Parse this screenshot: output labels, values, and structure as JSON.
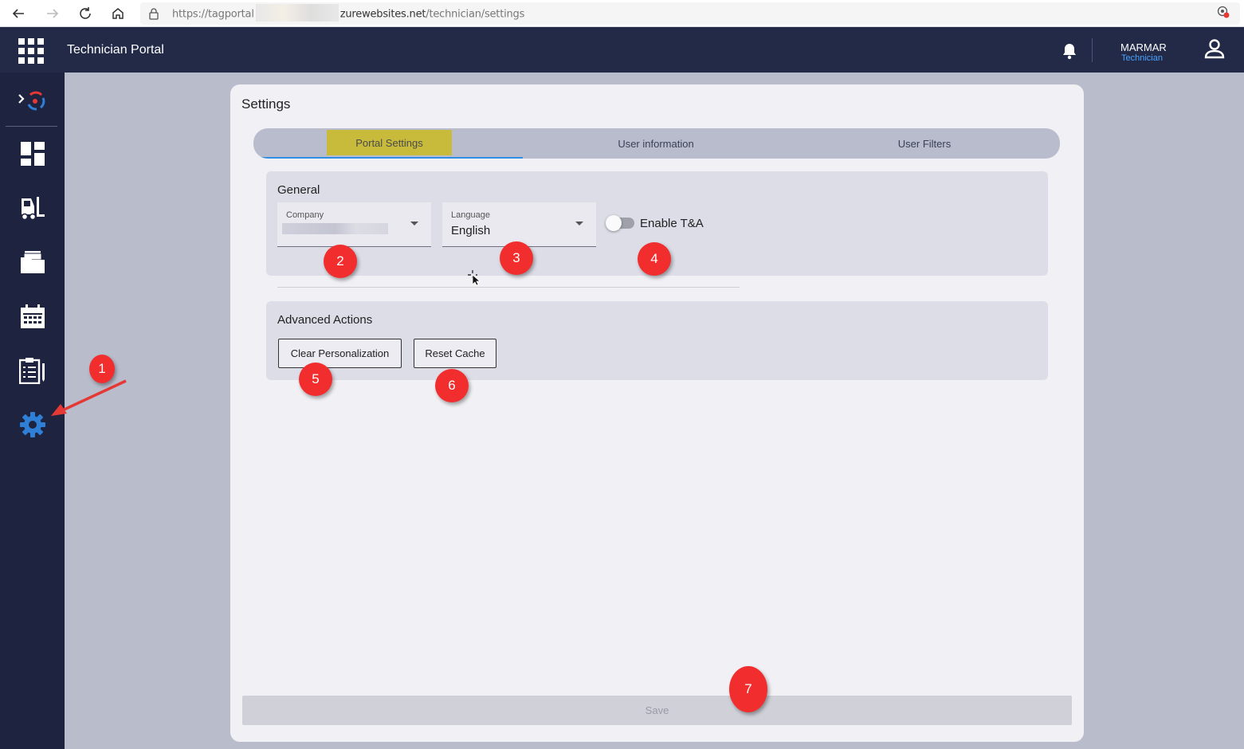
{
  "browser": {
    "url_prefix": "https://tagportal",
    "url_domain_suffix": "zurewebsites.net",
    "url_path": "/technician/settings"
  },
  "appbar": {
    "title": "Technician Portal",
    "user_name": "MARMAR",
    "user_role": "Technician"
  },
  "sidebar": {
    "items": [
      {
        "name": "logo",
        "icon": "logo-icon"
      },
      {
        "name": "dashboard",
        "icon": "dashboard-icon"
      },
      {
        "name": "equipment",
        "icon": "forklift-icon"
      },
      {
        "name": "documents",
        "icon": "folder-icon"
      },
      {
        "name": "calendar",
        "icon": "calendar-icon"
      },
      {
        "name": "checklist",
        "icon": "clipboard-icon"
      },
      {
        "name": "settings",
        "icon": "gear-icon",
        "active": true
      }
    ]
  },
  "page": {
    "title": "Settings",
    "tabs": [
      {
        "label": "Portal Settings",
        "active": true
      },
      {
        "label": "User information"
      },
      {
        "label": "User Filters"
      }
    ]
  },
  "general": {
    "title": "General",
    "company_label": "Company",
    "language_label": "Language",
    "language_value": "English",
    "toggle_label": "Enable T&A",
    "toggle_on": false
  },
  "advanced": {
    "title": "Advanced Actions",
    "clear_label": "Clear Personalization",
    "reset_label": "Reset Cache"
  },
  "footer": {
    "save_label": "Save",
    "save_enabled": false
  },
  "annotations": [
    "1",
    "2",
    "3",
    "4",
    "5",
    "6",
    "7"
  ],
  "colors": {
    "appbar": "#222a48",
    "sidebar": "#1e2440",
    "active_icon": "#2f7fd6",
    "tab_highlight": "#c8bb3c",
    "tab_underline": "#2f8de4",
    "marker": "#f22d2d"
  }
}
